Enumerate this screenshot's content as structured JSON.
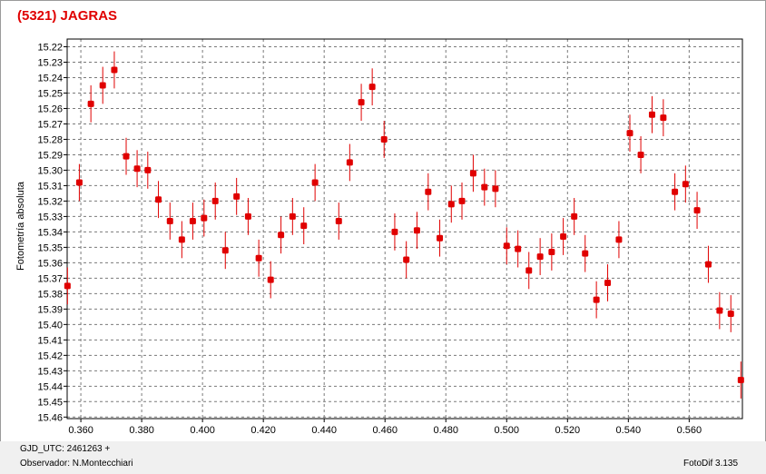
{
  "title": "(5321) JAGRAS",
  "footer": {
    "gjd": "GJD_UTC: 2461263 +",
    "observer": "Observador: N.Montecchiari",
    "version": "FotoDif 3.135"
  },
  "colors": {
    "points": "#e00000",
    "title": "#e00000",
    "grid": "#7a7a7a"
  },
  "chart_data": {
    "type": "scatter",
    "title": "(5321) JAGRAS",
    "xlabel": "",
    "ylabel": "Fotometría absoluta",
    "xlim": [
      0.3555,
      0.5775
    ],
    "ylim": [
      15.461,
      15.215
    ],
    "y_inverted": true,
    "grid": true,
    "x_ticks": [
      0.36,
      0.38,
      0.4,
      0.42,
      0.44,
      0.46,
      0.48,
      0.5,
      0.52,
      0.54,
      0.56
    ],
    "x_tick_labels": [
      "0.360",
      "0.380",
      "0.400",
      "0.420",
      "0.440",
      "0.460",
      "0.480",
      "0.500",
      "0.520",
      "0.540",
      "0.560"
    ],
    "y_ticks": [
      15.22,
      15.23,
      15.24,
      15.25,
      15.26,
      15.27,
      15.28,
      15.29,
      15.3,
      15.31,
      15.32,
      15.33,
      15.34,
      15.35,
      15.36,
      15.37,
      15.38,
      15.39,
      15.4,
      15.41,
      15.42,
      15.43,
      15.44,
      15.45,
      15.46
    ],
    "y_tick_labels": [
      "15.22",
      "15.23",
      "15.24",
      "15.25",
      "15.26",
      "15.27",
      "15.28",
      "15.29",
      "15.30",
      "15.31",
      "15.32",
      "15.33",
      "15.34",
      "15.35",
      "15.36",
      "15.37",
      "15.38",
      "15.39",
      "15.40",
      "15.41",
      "15.42",
      "15.43",
      "15.44",
      "15.45",
      "15.46"
    ],
    "error_bar": 0.012,
    "points": [
      {
        "x": 0.3556,
        "y": 15.375
      },
      {
        "x": 0.3595,
        "y": 15.308
      },
      {
        "x": 0.3633,
        "y": 15.257
      },
      {
        "x": 0.3672,
        "y": 15.245
      },
      {
        "x": 0.371,
        "y": 15.235
      },
      {
        "x": 0.3749,
        "y": 15.291
      },
      {
        "x": 0.3785,
        "y": 15.299
      },
      {
        "x": 0.382,
        "y": 15.3
      },
      {
        "x": 0.3855,
        "y": 15.319
      },
      {
        "x": 0.3893,
        "y": 15.333
      },
      {
        "x": 0.3932,
        "y": 15.345
      },
      {
        "x": 0.3968,
        "y": 15.333
      },
      {
        "x": 0.4005,
        "y": 15.331
      },
      {
        "x": 0.4042,
        "y": 15.32
      },
      {
        "x": 0.4075,
        "y": 15.352
      },
      {
        "x": 0.4112,
        "y": 15.317
      },
      {
        "x": 0.415,
        "y": 15.33
      },
      {
        "x": 0.4185,
        "y": 15.357
      },
      {
        "x": 0.4224,
        "y": 15.371
      },
      {
        "x": 0.4258,
        "y": 15.342
      },
      {
        "x": 0.4296,
        "y": 15.33
      },
      {
        "x": 0.4333,
        "y": 15.336
      },
      {
        "x": 0.437,
        "y": 15.308
      },
      {
        "x": 0.4448,
        "y": 15.333
      },
      {
        "x": 0.4484,
        "y": 15.295
      },
      {
        "x": 0.4522,
        "y": 15.256
      },
      {
        "x": 0.4558,
        "y": 15.246
      },
      {
        "x": 0.4597,
        "y": 15.28
      },
      {
        "x": 0.4632,
        "y": 15.34
      },
      {
        "x": 0.467,
        "y": 15.358
      },
      {
        "x": 0.4705,
        "y": 15.339
      },
      {
        "x": 0.4742,
        "y": 15.314
      },
      {
        "x": 0.478,
        "y": 15.344
      },
      {
        "x": 0.4818,
        "y": 15.322
      },
      {
        "x": 0.4853,
        "y": 15.32
      },
      {
        "x": 0.489,
        "y": 15.302
      },
      {
        "x": 0.4927,
        "y": 15.311
      },
      {
        "x": 0.4963,
        "y": 15.312
      },
      {
        "x": 0.5,
        "y": 15.349
      },
      {
        "x": 0.5037,
        "y": 15.351
      },
      {
        "x": 0.5073,
        "y": 15.365
      },
      {
        "x": 0.511,
        "y": 15.356
      },
      {
        "x": 0.5148,
        "y": 15.353
      },
      {
        "x": 0.5186,
        "y": 15.343
      },
      {
        "x": 0.5222,
        "y": 15.33
      },
      {
        "x": 0.5258,
        "y": 15.354
      },
      {
        "x": 0.5295,
        "y": 15.384
      },
      {
        "x": 0.5332,
        "y": 15.373
      },
      {
        "x": 0.5369,
        "y": 15.345
      },
      {
        "x": 0.5405,
        "y": 15.276
      },
      {
        "x": 0.5441,
        "y": 15.29
      },
      {
        "x": 0.5478,
        "y": 15.264
      },
      {
        "x": 0.5515,
        "y": 15.266
      },
      {
        "x": 0.5553,
        "y": 15.314
      },
      {
        "x": 0.5588,
        "y": 15.309
      },
      {
        "x": 0.5626,
        "y": 15.326
      },
      {
        "x": 0.5663,
        "y": 15.361
      },
      {
        "x": 0.57,
        "y": 15.391
      },
      {
        "x": 0.5737,
        "y": 15.393
      },
      {
        "x": 0.577,
        "y": 15.436
      }
    ]
  }
}
